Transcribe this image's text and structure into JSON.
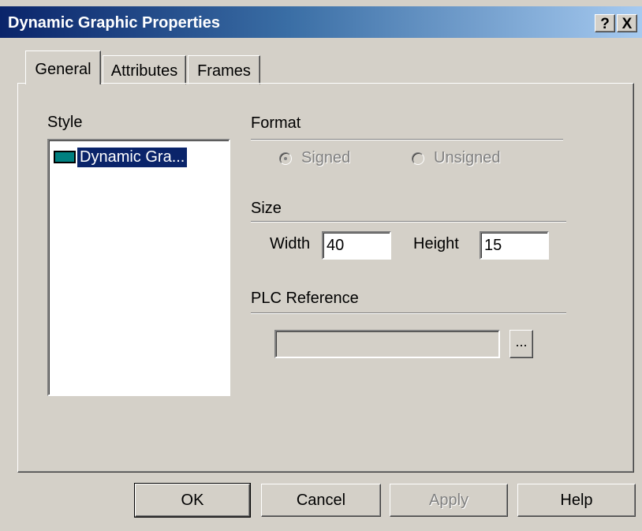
{
  "window": {
    "title": "Dynamic Graphic Properties",
    "help_btn": "?",
    "close_btn": "X"
  },
  "tabs": [
    {
      "label": "General",
      "active": true
    },
    {
      "label": "Attributes",
      "active": false
    },
    {
      "label": "Frames",
      "active": false
    }
  ],
  "style": {
    "label": "Style",
    "items": [
      {
        "label": "Dynamic Gra...",
        "icon": "style-swatch-icon",
        "selected": true
      }
    ]
  },
  "format": {
    "label": "Format",
    "options": [
      {
        "label": "Signed",
        "checked": true,
        "enabled": false
      },
      {
        "label": "Unsigned",
        "checked": false,
        "enabled": false
      }
    ]
  },
  "size": {
    "label": "Size",
    "width_label": "Width",
    "width_value": "40",
    "height_label": "Height",
    "height_value": "15"
  },
  "plc": {
    "label": "PLC Reference",
    "value": "",
    "browse_label": "..."
  },
  "buttons": {
    "ok": "OK",
    "cancel": "Cancel",
    "apply": "Apply",
    "help": "Help"
  },
  "colors": {
    "title_start": "#0a246a",
    "title_end": "#a6caf0",
    "face": "#d4d0c8",
    "selection": "#0a246a",
    "icon_fill": "#008080"
  }
}
